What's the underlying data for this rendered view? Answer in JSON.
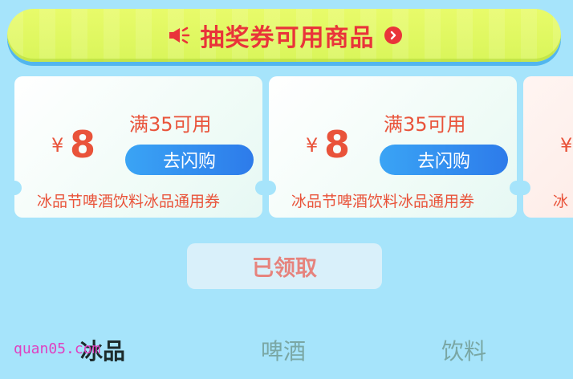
{
  "banner": {
    "title": "抽奖券可用商品",
    "icons": {
      "left": "megaphone-icon",
      "right": "chevron-right-circle-icon"
    },
    "colors": {
      "title": "#e9343a",
      "background": "#dcf65c"
    }
  },
  "coupons": [
    {
      "currency": "¥",
      "amount": "8",
      "condition": "满35可用",
      "button_label": "去闪购",
      "description": "冰品节啤酒饮料冰品通用券"
    },
    {
      "currency": "¥",
      "amount": "8",
      "condition": "满35可用",
      "button_label": "去闪购",
      "description": "冰品节啤酒饮料冰品通用券"
    },
    {
      "currency": "¥",
      "description": "冰"
    }
  ],
  "claimed_button": {
    "label": "已领取"
  },
  "tabs": [
    {
      "label": "冰品",
      "active": true
    },
    {
      "label": "啤酒",
      "active": false
    },
    {
      "label": "饮料",
      "active": false
    }
  ],
  "watermark": "quan05.com",
  "colors": {
    "background": "#a6e4fb",
    "accent_red": "#e9533a",
    "button_blue": "#2d7bea"
  }
}
